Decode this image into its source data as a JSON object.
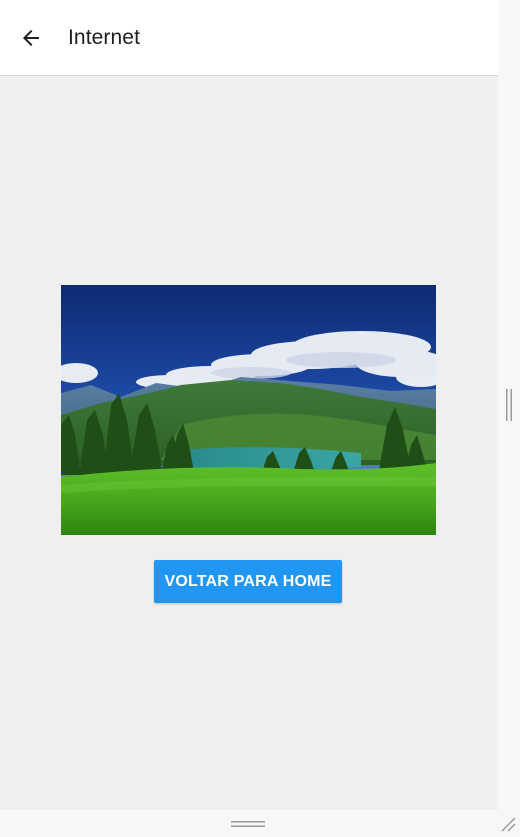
{
  "header": {
    "title": "Internet",
    "back_icon": "arrow-left-icon"
  },
  "main": {
    "image_alt": "",
    "button_label": "VOLTAR PARA HOME"
  },
  "colors": {
    "header_bg": "#ffffff",
    "content_bg": "#efefef",
    "button_bg": "#2196f3",
    "button_text": "#ffffff",
    "title_text": "#1f1f1f"
  }
}
